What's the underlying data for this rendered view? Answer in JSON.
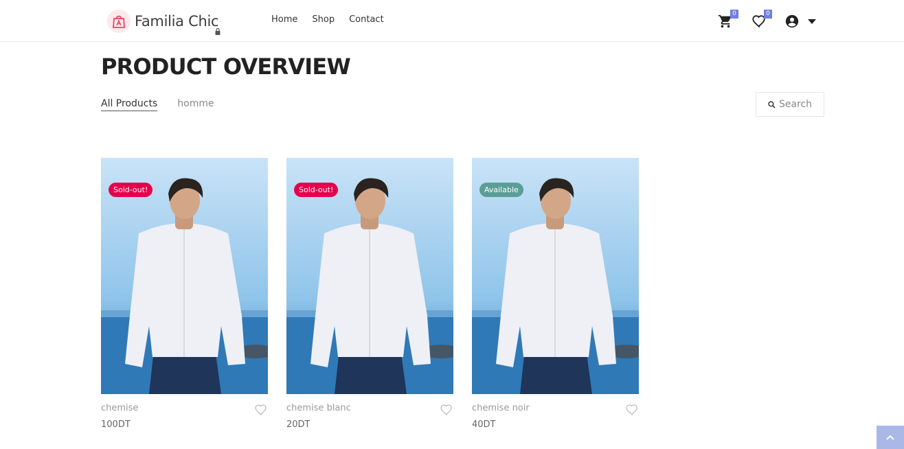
{
  "brand": {
    "name": "Familia Chic",
    "icon": "shopping-bag-icon"
  },
  "nav": [
    {
      "label": "Home"
    },
    {
      "label": "Shop"
    },
    {
      "label": "Contact"
    }
  ],
  "header_icons": {
    "cart": {
      "icon": "cart-icon",
      "count": "0"
    },
    "wishlist": {
      "icon": "heart-icon",
      "count": "0"
    },
    "account": {
      "icon": "user-circle-icon"
    },
    "account_menu": {
      "icon": "caret-down-icon"
    }
  },
  "page": {
    "title": "PRODUCT OVERVIEW"
  },
  "filters": [
    {
      "label": "All Products",
      "active": true
    },
    {
      "label": "homme",
      "active": false
    }
  ],
  "search": {
    "label": "Search",
    "icon": "search-icon"
  },
  "products": [
    {
      "name": "chemise",
      "price": "100DT",
      "status": "Sold-out!",
      "status_color": "#e6004c"
    },
    {
      "name": "chemise blanc",
      "price": "20DT",
      "status": "Sold-out!",
      "status_color": "#e6004c"
    },
    {
      "name": "chemise noir",
      "price": "40DT",
      "status": "Available",
      "status_color": "#5a9e96"
    }
  ],
  "colors": {
    "accent": "#717fe0",
    "sold_out": "#e6004c",
    "available": "#5a9e96",
    "back_to_top": "#a9b8e6"
  }
}
